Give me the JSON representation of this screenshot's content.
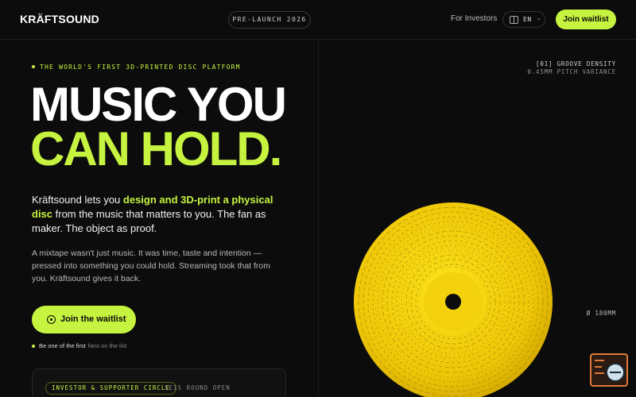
{
  "header": {
    "logo": "KRÄFTSOUND",
    "badge": "PRE-LAUNCH 2026",
    "investors_link": "For Investors",
    "language": "EN",
    "join_button": "Join waitlist"
  },
  "hero": {
    "eyebrow": "THE WORLD'S FIRST 3D-PRINTED DISC PLATFORM",
    "headline_line1": "MUSIC YOU",
    "headline_line2": "CAN HOLD.",
    "lead_prefix": "Kräftsound lets you ",
    "lead_highlight": "design and 3D-print a physical disc",
    "lead_suffix": " from the music that matters to you. The fan as maker. The object as proof.",
    "sub": "A mixtape wasn't just music. It was time, taste and intention — pressed into something you could hold. Streaming took that from you. Kräftsound gives it back.",
    "cta": "Join the waitlist",
    "social_strong": "Be one of the first",
    "social_rest": "fans on the list"
  },
  "investor_card": {
    "pill": "INVESTOR & SUPPORTER CIRCLE",
    "note": "SEIS ROUND OPEN"
  },
  "spec": {
    "line1": "[01] GROOVE DENSITY",
    "line2": "0.45MM PITCH VARIANCE",
    "size": "Ø 180MM"
  },
  "colors": {
    "accent": "#c6f33f",
    "background": "#0c0c0c",
    "disc": "#f5d20a"
  },
  "icons": {
    "lang": "globe-icon",
    "cta": "target-icon",
    "fab": "window-search-icon"
  }
}
